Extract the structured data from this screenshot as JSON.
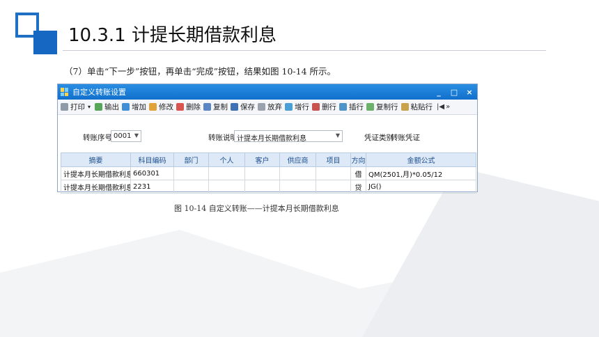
{
  "slide": {
    "title": "10.3.1  计提长期借款利息",
    "instruction": "（7）单击“下一步”按钮，再单击“完成”按钮，结果如图 10-14 所示。",
    "caption": "图 10-14  自定义转账——计提本月长期借款利息",
    "accent_color": "#1567c2"
  },
  "window": {
    "title": "自定义转账设置",
    "controls": {
      "minimize": "_",
      "maximize": "□",
      "close": "×"
    },
    "icon": "app-grid-icon"
  },
  "toolbar": {
    "print": "打印",
    "export": "输出",
    "add": "增加",
    "edit": "修改",
    "delete": "删除",
    "copy": "复制",
    "save": "保存",
    "abandon": "放弃",
    "add_row": "增行",
    "delete_row": "删行",
    "insert_row": "插行",
    "copy_row": "复制行",
    "paste_row": "粘贴行",
    "first_icon": "first-record-icon",
    "more": "»"
  },
  "form": {
    "transfer_no_label": "转账序号",
    "transfer_no_value": "0001",
    "transfer_desc_label": "转账说明",
    "transfer_desc_value": "计提本月长期借款利息",
    "voucher_type_label": "凭证类别",
    "voucher_type_value": "转账凭证"
  },
  "grid": {
    "columns": [
      "摘要",
      "科目编码",
      "部门",
      "个人",
      "客户",
      "供应商",
      "项目",
      "方向",
      "金额公式"
    ],
    "rows": [
      [
        "计提本月长期借款利息",
        "660301",
        "",
        "",
        "",
        "",
        "",
        "借",
        "QM(2501,月)*0.05/12"
      ],
      [
        "计提本月长期借款利息",
        "2231",
        "",
        "",
        "",
        "",
        "",
        "贷",
        "JG()"
      ]
    ]
  }
}
